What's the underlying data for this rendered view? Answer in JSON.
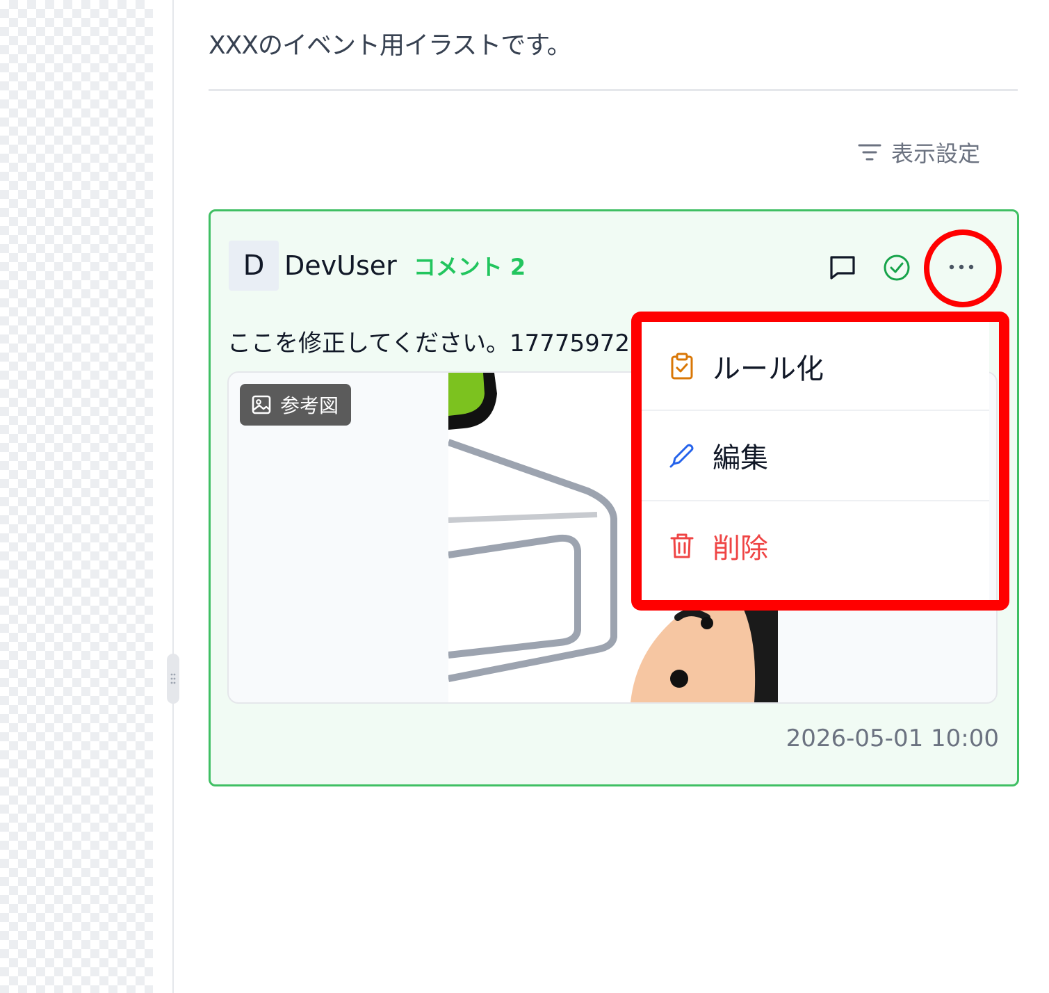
{
  "description": "XXXのイベント用イラストです。",
  "toolbar": {
    "display_settings_label": "表示設定",
    "display_settings_icon": "filter-icon"
  },
  "comment": {
    "avatar_initial": "D",
    "user_name": "DevUser",
    "badge": "コメント 2",
    "body": "ここを修正してください。1777597205",
    "reference_label": "参考図",
    "timestamp": "2026-05-01 10:00",
    "actions": {
      "reply_icon": "comment-icon",
      "resolve_icon": "check-circle-icon",
      "more_icon": "ellipsis-icon"
    }
  },
  "menu": {
    "items": [
      {
        "label": "ルール化",
        "icon": "clipboard-check-icon",
        "color": "#111827"
      },
      {
        "label": "編集",
        "icon": "pencil-icon",
        "color": "#111827"
      },
      {
        "label": "削除",
        "icon": "trash-icon",
        "color": "#ef4444"
      }
    ]
  },
  "colors": {
    "accent_green": "#3fbf63",
    "card_background": "#f1fbf4",
    "highlight_red": "#ff0000",
    "danger": "#ef4444",
    "rule_icon": "#d97706",
    "edit_icon": "#2563eb"
  }
}
